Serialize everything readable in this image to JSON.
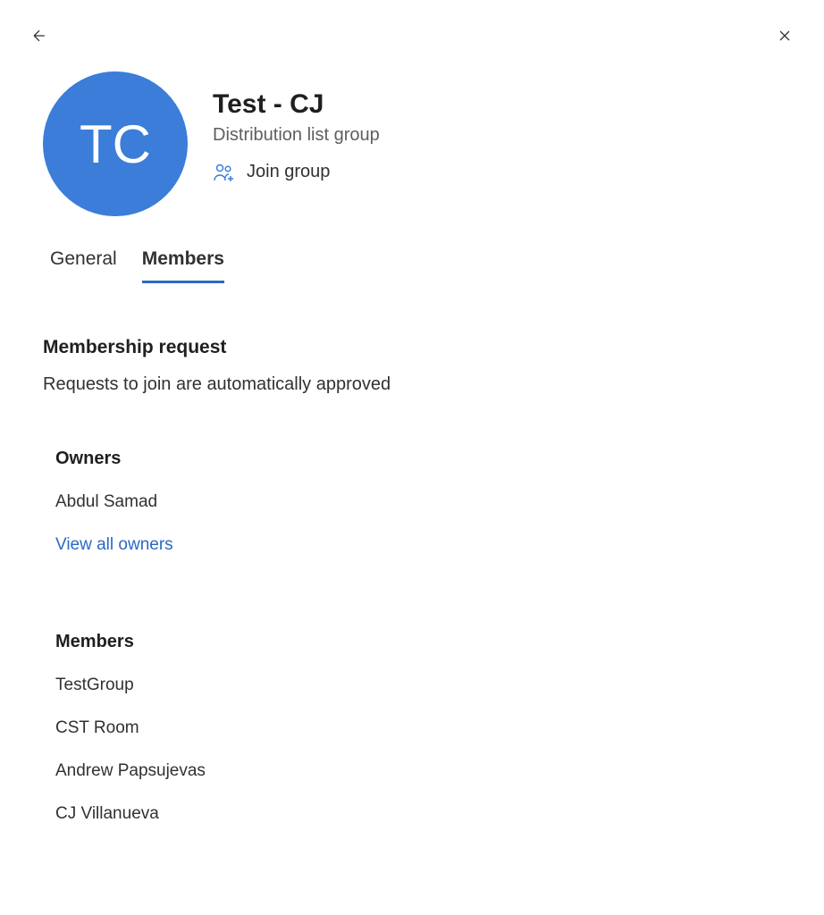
{
  "header": {
    "avatar_initials": "TC",
    "title": "Test - CJ",
    "subtitle": "Distribution list group",
    "join_label": "Join group"
  },
  "tabs": {
    "general": "General",
    "members": "Members"
  },
  "membership_request": {
    "heading": "Membership request",
    "description": "Requests to join are automatically approved"
  },
  "owners": {
    "heading": "Owners",
    "items": [
      "Abdul Samad"
    ],
    "view_all": "View all owners"
  },
  "members": {
    "heading": "Members",
    "items": [
      "TestGroup",
      "CST Room",
      "Andrew Papsujevas",
      "CJ Villanueva"
    ]
  }
}
